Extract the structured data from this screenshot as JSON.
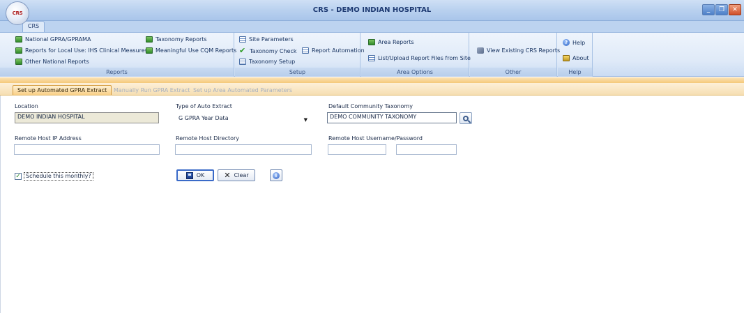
{
  "window": {
    "title": "CRS - DEMO INDIAN HOSPITAL",
    "orb_label": "CRS",
    "minimize": "_",
    "maximize": "❐",
    "close": "✕"
  },
  "ribbon_tabs": [
    "CRS"
  ],
  "ribbon": {
    "reports": {
      "label": "Reports",
      "items": [
        "National GPRA/GPRAMA",
        "Reports for Local Use: IHS Clinical Measures",
        "Other National Reports",
        "Taxonomy Reports",
        "Meaningful Use CQM Reports"
      ]
    },
    "setup": {
      "label": "Setup",
      "items": [
        "Site Parameters",
        "Taxonomy Check",
        "Taxonomy Setup",
        "Report Automation"
      ]
    },
    "area_options": {
      "label": "Area Options",
      "items": [
        "Area Reports",
        "List/Upload Report Files from Site"
      ]
    },
    "other": {
      "label": "Other",
      "items": [
        "View Existing CRS Reports"
      ]
    },
    "help": {
      "label": "Help",
      "items": [
        "Help",
        "About"
      ]
    }
  },
  "content_tabs": [
    {
      "label": "Set up Automated GPRA Extract",
      "active": true
    },
    {
      "label": "Manually Run GPRA Extract",
      "active": false
    },
    {
      "label": "Set up Area Automated Parameters",
      "active": false
    }
  ],
  "form": {
    "location_label": "Location",
    "location_value": "DEMO INDIAN HOSPITAL",
    "extract_type_label": "Type of Auto Extract",
    "extract_type_value": "G GPRA Year Data",
    "taxonomy_label": "Default Community Taxonomy",
    "taxonomy_value": "DEMO COMMUNITY TAXONOMY",
    "ip_label": "Remote Host IP Address",
    "ip_value": "",
    "dir_label": "Remote Host Directory",
    "dir_value": "",
    "userpass_label": "Remote Host Username/Password",
    "username_value": "",
    "password_value": "",
    "schedule_label": "Schedule this monthly?",
    "schedule_checked": true,
    "ok_label": "OK",
    "clear_label": "Clear"
  },
  "icons": {
    "lookup": "magnifier-icon",
    "info": "info-icon",
    "save": "save-disk-icon",
    "clear": "x-icon"
  }
}
